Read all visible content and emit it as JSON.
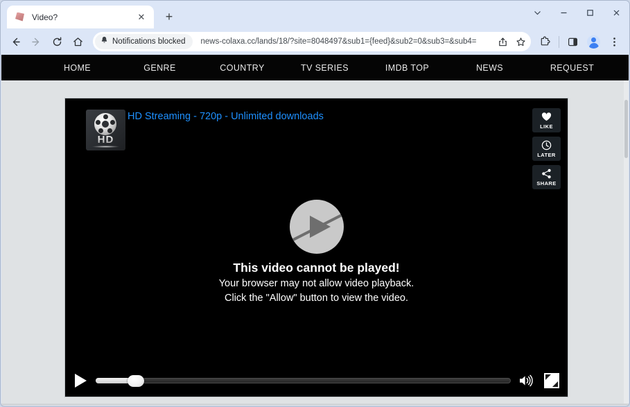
{
  "window": {
    "controls": {
      "tab_search": "tab-search-chevron",
      "minimize": "minimize",
      "maximize": "maximize",
      "close": "close"
    }
  },
  "tabstrip": {
    "tabs": [
      {
        "title": "Video?",
        "favicon": "video-site-favicon",
        "close_label": "✕"
      }
    ],
    "new_tab_label": "+"
  },
  "toolbar": {
    "back_icon": "back-arrow-icon",
    "forward_icon": "forward-arrow-icon",
    "reload_icon": "reload-icon",
    "home_icon": "home-icon",
    "notification_chip": {
      "icon": "bell-blocked-icon",
      "label": "Notifications blocked"
    },
    "url": "news-colaxa.cc/lands/18/?site=8048497&sub1={feed}&sub2=0&sub3=&sub4=",
    "share_icon": "share-icon",
    "bookmark_icon": "bookmark-star-icon",
    "extensions_icon": "extensions-puzzle-icon",
    "side_panel_icon": "side-panel-icon",
    "profile_icon": "profile-avatar-icon",
    "menu_icon": "three-dot-menu-icon"
  },
  "site": {
    "nav": [
      {
        "label": "HOME"
      },
      {
        "label": "GENRE"
      },
      {
        "label": "COUNTRY"
      },
      {
        "label": "TV SERIES"
      },
      {
        "label": "IMDB TOP"
      },
      {
        "label": "NEWS"
      },
      {
        "label": "REQUEST"
      }
    ],
    "player": {
      "badge": {
        "icon": "film-reel-icon",
        "text": "HD"
      },
      "promo_link": "HD Streaming - 720p - Unlimited downloads",
      "promo_color": "#1e90ff",
      "side_buttons": [
        {
          "label": "LIKE",
          "icon": "heart-icon"
        },
        {
          "label": "LATER",
          "icon": "clock-icon"
        },
        {
          "label": "SHARE",
          "icon": "share-nodes-icon"
        }
      ],
      "overlay_icon": "play-blocked-icon",
      "error": {
        "title": "This video cannot be played!",
        "line1": "Your browser may not allow video playback.",
        "line2": "Click the \"Allow\" button to view the video."
      },
      "controls": {
        "play_icon": "play-icon",
        "progress_percent": 0,
        "volume_icon": "volume-icon",
        "fullscreen_icon": "fullscreen-icon"
      }
    }
  }
}
